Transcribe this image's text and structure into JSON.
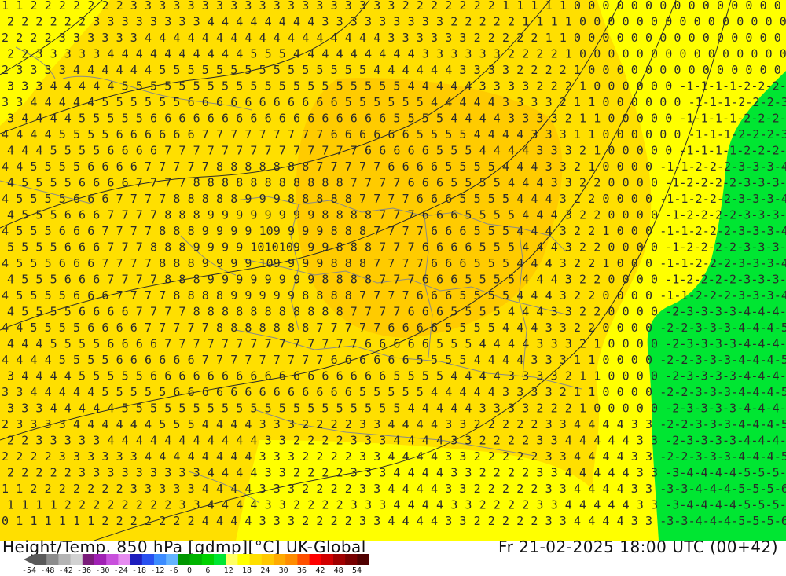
{
  "header": {
    "product": "Height/Temp. 850 hPa [gdmp][°C] UK-Global",
    "valid_time": "Fr 21-02-2025 18:00 UTC (00+42)"
  },
  "colorbar": {
    "labels": [
      "-54",
      "-48",
      "-42",
      "-36",
      "-30",
      "-24",
      "-18",
      "-12",
      "-6",
      "0",
      "6",
      "12",
      "18",
      "24",
      "30",
      "36",
      "42",
      "48",
      "54"
    ],
    "colors": [
      "#5a5a5a",
      "#8c8c8c",
      "#b4b4b4",
      "#d2d2d2",
      "#7a1c7a",
      "#a020b4",
      "#c850dc",
      "#e68cf0",
      "#1e1ebe",
      "#2850f0",
      "#3c8cff",
      "#64b4ff",
      "#009600",
      "#00b400",
      "#00d200",
      "#00e632",
      "#ffff64",
      "#ffff00",
      "#ffdf00",
      "#ffc800",
      "#ffaa00",
      "#ff8c00",
      "#ff5000",
      "#ff0000",
      "#d20000",
      "#a00000",
      "#780000",
      "#500000"
    ]
  },
  "map": {
    "zones": [
      {
        "name": "cold-east",
        "color": "#00e632"
      },
      {
        "name": "cool",
        "color": "#ffff00"
      },
      {
        "name": "mild",
        "color": "#ffdf00"
      },
      {
        "name": "warm",
        "color": "#ffc800"
      }
    ],
    "label_color": "#2a2a2a",
    "contour_color": "#2a2a2a",
    "border_color": "#9a9a9a"
  }
}
